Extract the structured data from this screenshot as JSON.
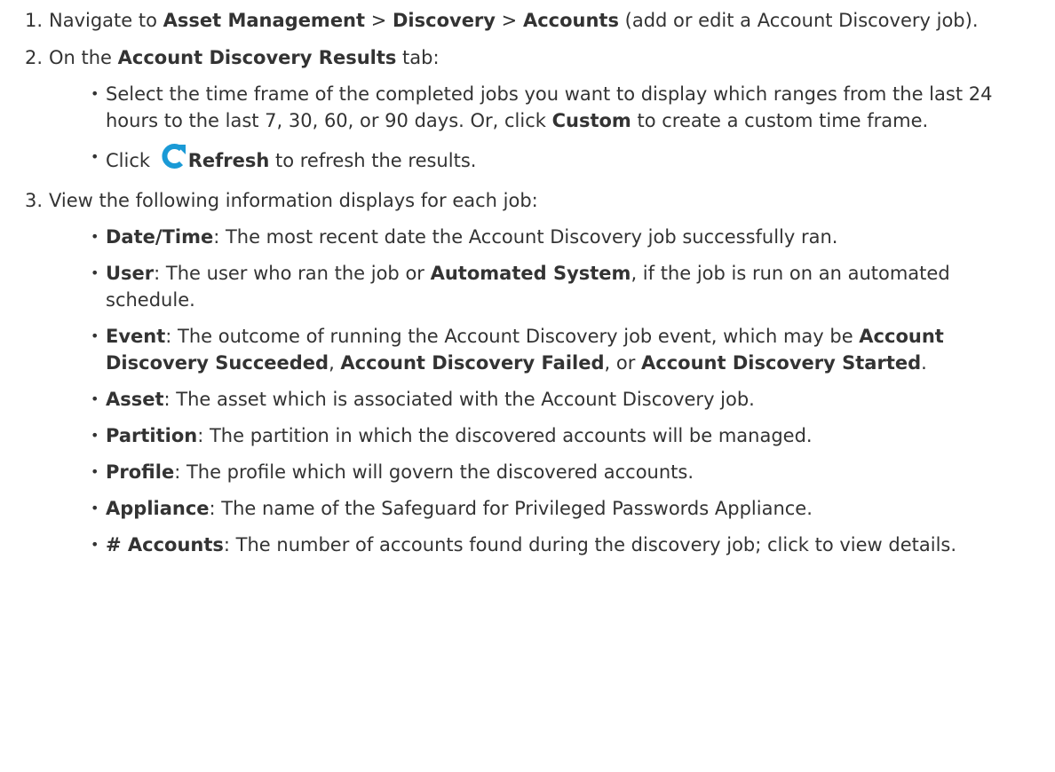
{
  "steps": [
    {
      "num": "1.",
      "pre": "Navigate to ",
      "b1": "Asset Management",
      "sep1": " > ",
      "b2": "Discovery",
      "sep2": " > ",
      "b3": "Accounts",
      "post": " (add or edit a Account Discovery job)."
    },
    {
      "num": "2.",
      "pre": "On the ",
      "bold": "Account Discovery Results",
      "post": " tab:",
      "bullets": {
        "timeframe": {
          "text": "Select the time frame of the completed jobs you want to display which ranges from the last 24 hours to the last 7, 30, 60, or 90 days. Or, click ",
          "bold": "Custom",
          "post": " to create a custom time frame."
        },
        "refresh": {
          "pre": "Click ",
          "icon": "refresh-icon",
          "bold": "Refresh",
          "post": " to refresh the results."
        }
      }
    },
    {
      "num": "3.",
      "text": "View the following information displays for each job:",
      "fields": {
        "datetime": {
          "term": "Date/Time",
          "desc": ": The most recent date the Account Discovery job successfully ran."
        },
        "user": {
          "term": "User",
          "desc": ": The user who ran the job or ",
          "bold": "Automated System",
          "post": ", if the job is run on an automated schedule."
        },
        "event": {
          "term": "Event",
          "desc": ": The outcome of running the Account Discovery job event, which may be ",
          "b1": "Account Discovery Succeeded",
          "sep1": ", ",
          "b2": "Account Discovery Failed",
          "sep2": ", or ",
          "b3": "Account Discovery Started",
          "post": "."
        },
        "asset": {
          "term": "Asset",
          "desc": ": The asset which is associated with the Account Discovery job."
        },
        "partition": {
          "term": "Partition",
          "desc": ": The partition in which the discovered accounts will be managed."
        },
        "profile": {
          "term": "Profile",
          "desc": ": The profile which will govern the discovered accounts."
        },
        "appliance": {
          "term": "Appliance",
          "desc": ": The name of the Safeguard for Privileged Passwords Appliance."
        },
        "accounts": {
          "term": "# Accounts",
          "desc": ": The number of accounts found during the discovery job; click to view details."
        }
      }
    }
  ],
  "bullet_char": "•",
  "colors": {
    "text": "#333333",
    "refresh_icon": "#1a9ad6"
  }
}
